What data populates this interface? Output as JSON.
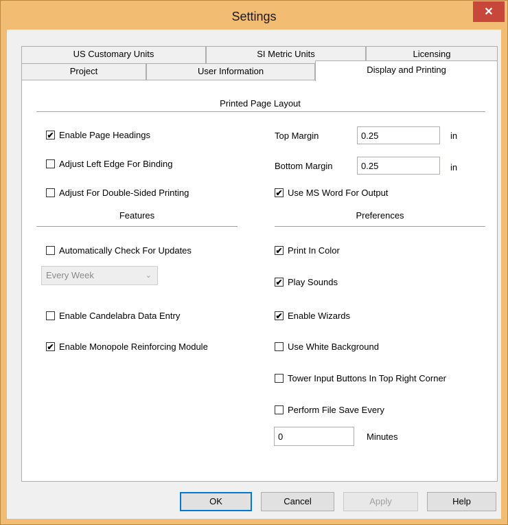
{
  "window": {
    "title": "Settings"
  },
  "tabs": {
    "row_back": [
      {
        "label": "US Customary Units"
      },
      {
        "label": "SI Metric Units"
      },
      {
        "label": "Licensing"
      }
    ],
    "row_front": [
      {
        "label": "Project"
      },
      {
        "label": "User Information"
      },
      {
        "label": "Display and Printing",
        "active": true
      }
    ]
  },
  "printed_page_layout": {
    "title": "Printed Page Layout",
    "options": [
      {
        "label": "Enable Page Headings",
        "checked": true
      },
      {
        "label": "Adjust Left Edge For Binding",
        "checked": false
      },
      {
        "label": "Adjust For Double-Sided Printing",
        "checked": false
      }
    ],
    "top_margin": {
      "label": "Top Margin",
      "value": "0.25",
      "unit": "in"
    },
    "bottom_margin": {
      "label": "Bottom Margin",
      "value": "0.25",
      "unit": "in"
    },
    "use_ms_word": {
      "label": "Use MS Word For Output",
      "checked": true
    }
  },
  "features": {
    "title": "Features",
    "auto_check_updates": {
      "label": "Automatically Check For Updates",
      "checked": false
    },
    "update_frequency": {
      "value": "Every Week"
    },
    "candelabra": {
      "label": "Enable Candelabra Data Entry",
      "checked": false
    },
    "monopole": {
      "label": "Enable Monopole Reinforcing Module",
      "checked": true
    }
  },
  "preferences": {
    "title": "Preferences",
    "options": [
      {
        "label": "Print In Color",
        "checked": true
      },
      {
        "label": "Play Sounds",
        "checked": true
      },
      {
        "label": "Enable Wizards",
        "checked": true
      },
      {
        "label": "Use White Background",
        "checked": false
      },
      {
        "label": "Tower Input Buttons In Top Right Corner",
        "checked": false
      },
      {
        "label": "Perform File Save Every",
        "checked": false
      }
    ],
    "save_interval": {
      "value": "0",
      "unit": "Minutes"
    }
  },
  "buttons": {
    "ok": "OK",
    "cancel": "Cancel",
    "apply": "Apply",
    "help": "Help"
  },
  "icons": {
    "close": "close-icon",
    "check": "checkmark-icon",
    "dropdown": "chevron-down-icon"
  }
}
